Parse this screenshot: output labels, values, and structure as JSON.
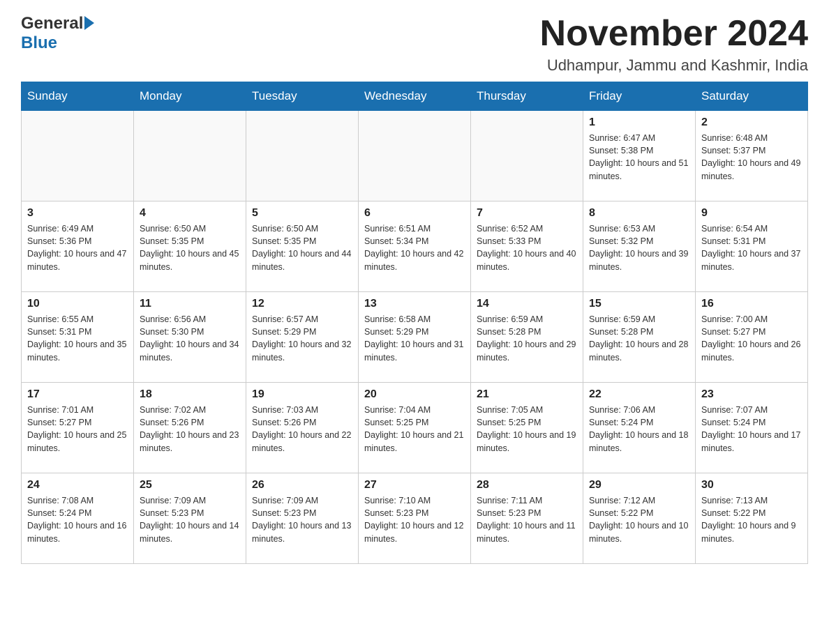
{
  "header": {
    "logo_general": "General",
    "logo_blue": "Blue",
    "month_title": "November 2024",
    "location": "Udhampur, Jammu and Kashmir, India"
  },
  "days_of_week": [
    "Sunday",
    "Monday",
    "Tuesday",
    "Wednesday",
    "Thursday",
    "Friday",
    "Saturday"
  ],
  "weeks": [
    [
      {
        "day": "",
        "sunrise": "",
        "sunset": "",
        "daylight": ""
      },
      {
        "day": "",
        "sunrise": "",
        "sunset": "",
        "daylight": ""
      },
      {
        "day": "",
        "sunrise": "",
        "sunset": "",
        "daylight": ""
      },
      {
        "day": "",
        "sunrise": "",
        "sunset": "",
        "daylight": ""
      },
      {
        "day": "",
        "sunrise": "",
        "sunset": "",
        "daylight": ""
      },
      {
        "day": "1",
        "sunrise": "Sunrise: 6:47 AM",
        "sunset": "Sunset: 5:38 PM",
        "daylight": "Daylight: 10 hours and 51 minutes."
      },
      {
        "day": "2",
        "sunrise": "Sunrise: 6:48 AM",
        "sunset": "Sunset: 5:37 PM",
        "daylight": "Daylight: 10 hours and 49 minutes."
      }
    ],
    [
      {
        "day": "3",
        "sunrise": "Sunrise: 6:49 AM",
        "sunset": "Sunset: 5:36 PM",
        "daylight": "Daylight: 10 hours and 47 minutes."
      },
      {
        "day": "4",
        "sunrise": "Sunrise: 6:50 AM",
        "sunset": "Sunset: 5:35 PM",
        "daylight": "Daylight: 10 hours and 45 minutes."
      },
      {
        "day": "5",
        "sunrise": "Sunrise: 6:50 AM",
        "sunset": "Sunset: 5:35 PM",
        "daylight": "Daylight: 10 hours and 44 minutes."
      },
      {
        "day": "6",
        "sunrise": "Sunrise: 6:51 AM",
        "sunset": "Sunset: 5:34 PM",
        "daylight": "Daylight: 10 hours and 42 minutes."
      },
      {
        "day": "7",
        "sunrise": "Sunrise: 6:52 AM",
        "sunset": "Sunset: 5:33 PM",
        "daylight": "Daylight: 10 hours and 40 minutes."
      },
      {
        "day": "8",
        "sunrise": "Sunrise: 6:53 AM",
        "sunset": "Sunset: 5:32 PM",
        "daylight": "Daylight: 10 hours and 39 minutes."
      },
      {
        "day": "9",
        "sunrise": "Sunrise: 6:54 AM",
        "sunset": "Sunset: 5:31 PM",
        "daylight": "Daylight: 10 hours and 37 minutes."
      }
    ],
    [
      {
        "day": "10",
        "sunrise": "Sunrise: 6:55 AM",
        "sunset": "Sunset: 5:31 PM",
        "daylight": "Daylight: 10 hours and 35 minutes."
      },
      {
        "day": "11",
        "sunrise": "Sunrise: 6:56 AM",
        "sunset": "Sunset: 5:30 PM",
        "daylight": "Daylight: 10 hours and 34 minutes."
      },
      {
        "day": "12",
        "sunrise": "Sunrise: 6:57 AM",
        "sunset": "Sunset: 5:29 PM",
        "daylight": "Daylight: 10 hours and 32 minutes."
      },
      {
        "day": "13",
        "sunrise": "Sunrise: 6:58 AM",
        "sunset": "Sunset: 5:29 PM",
        "daylight": "Daylight: 10 hours and 31 minutes."
      },
      {
        "day": "14",
        "sunrise": "Sunrise: 6:59 AM",
        "sunset": "Sunset: 5:28 PM",
        "daylight": "Daylight: 10 hours and 29 minutes."
      },
      {
        "day": "15",
        "sunrise": "Sunrise: 6:59 AM",
        "sunset": "Sunset: 5:28 PM",
        "daylight": "Daylight: 10 hours and 28 minutes."
      },
      {
        "day": "16",
        "sunrise": "Sunrise: 7:00 AM",
        "sunset": "Sunset: 5:27 PM",
        "daylight": "Daylight: 10 hours and 26 minutes."
      }
    ],
    [
      {
        "day": "17",
        "sunrise": "Sunrise: 7:01 AM",
        "sunset": "Sunset: 5:27 PM",
        "daylight": "Daylight: 10 hours and 25 minutes."
      },
      {
        "day": "18",
        "sunrise": "Sunrise: 7:02 AM",
        "sunset": "Sunset: 5:26 PM",
        "daylight": "Daylight: 10 hours and 23 minutes."
      },
      {
        "day": "19",
        "sunrise": "Sunrise: 7:03 AM",
        "sunset": "Sunset: 5:26 PM",
        "daylight": "Daylight: 10 hours and 22 minutes."
      },
      {
        "day": "20",
        "sunrise": "Sunrise: 7:04 AM",
        "sunset": "Sunset: 5:25 PM",
        "daylight": "Daylight: 10 hours and 21 minutes."
      },
      {
        "day": "21",
        "sunrise": "Sunrise: 7:05 AM",
        "sunset": "Sunset: 5:25 PM",
        "daylight": "Daylight: 10 hours and 19 minutes."
      },
      {
        "day": "22",
        "sunrise": "Sunrise: 7:06 AM",
        "sunset": "Sunset: 5:24 PM",
        "daylight": "Daylight: 10 hours and 18 minutes."
      },
      {
        "day": "23",
        "sunrise": "Sunrise: 7:07 AM",
        "sunset": "Sunset: 5:24 PM",
        "daylight": "Daylight: 10 hours and 17 minutes."
      }
    ],
    [
      {
        "day": "24",
        "sunrise": "Sunrise: 7:08 AM",
        "sunset": "Sunset: 5:24 PM",
        "daylight": "Daylight: 10 hours and 16 minutes."
      },
      {
        "day": "25",
        "sunrise": "Sunrise: 7:09 AM",
        "sunset": "Sunset: 5:23 PM",
        "daylight": "Daylight: 10 hours and 14 minutes."
      },
      {
        "day": "26",
        "sunrise": "Sunrise: 7:09 AM",
        "sunset": "Sunset: 5:23 PM",
        "daylight": "Daylight: 10 hours and 13 minutes."
      },
      {
        "day": "27",
        "sunrise": "Sunrise: 7:10 AM",
        "sunset": "Sunset: 5:23 PM",
        "daylight": "Daylight: 10 hours and 12 minutes."
      },
      {
        "day": "28",
        "sunrise": "Sunrise: 7:11 AM",
        "sunset": "Sunset: 5:23 PM",
        "daylight": "Daylight: 10 hours and 11 minutes."
      },
      {
        "day": "29",
        "sunrise": "Sunrise: 7:12 AM",
        "sunset": "Sunset: 5:22 PM",
        "daylight": "Daylight: 10 hours and 10 minutes."
      },
      {
        "day": "30",
        "sunrise": "Sunrise: 7:13 AM",
        "sunset": "Sunset: 5:22 PM",
        "daylight": "Daylight: 10 hours and 9 minutes."
      }
    ]
  ]
}
